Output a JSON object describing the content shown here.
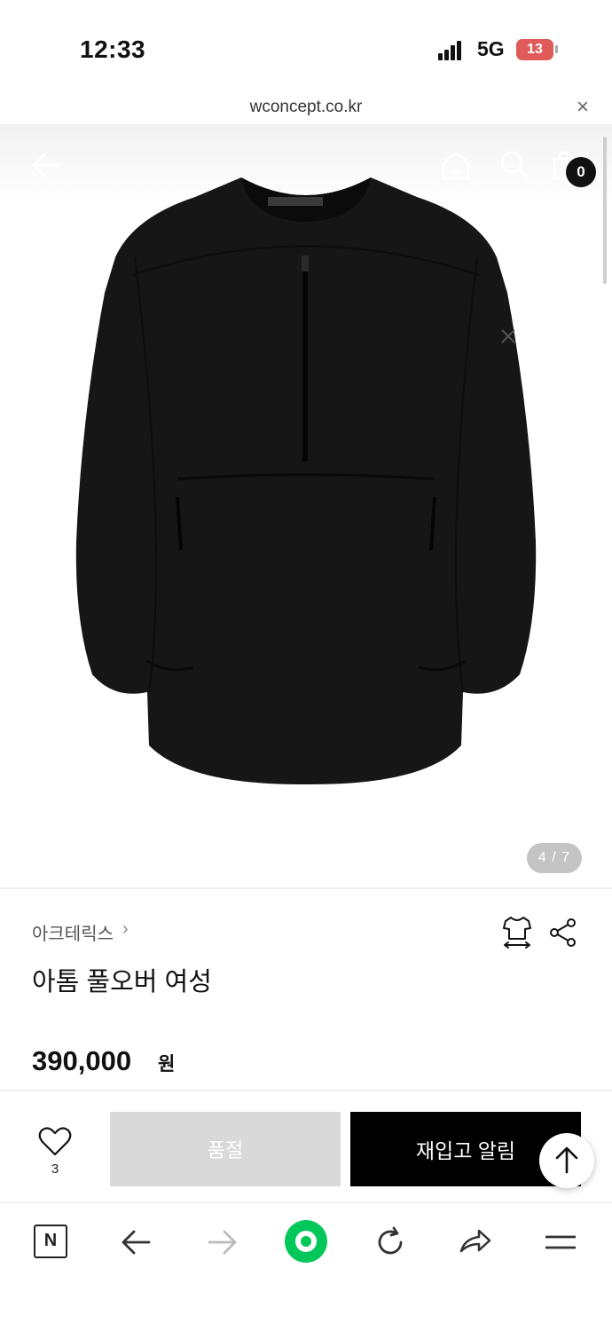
{
  "status_bar": {
    "time": "12:33",
    "network": "5G",
    "battery": "13"
  },
  "url_bar": {
    "url": "wconcept.co.kr",
    "close_symbol": "×"
  },
  "product_image": {
    "counter": "4 / 7",
    "cart_count": "0",
    "brand_logo_text": "ARC'TERYX"
  },
  "product": {
    "brand": "아크테릭스",
    "brand_chevron": "›",
    "title": "아톰 풀오버 여성",
    "price": "390,000",
    "price_unit": "원"
  },
  "purchase_bar": {
    "like_count": "3",
    "soldout_label": "품절",
    "restock_label": "재입고 알림"
  },
  "browser_nav": {
    "home_label": "N"
  },
  "colors": {
    "accent_green": "#03C75A",
    "button_black": "#000000",
    "soldout_gray": "#D9D9D9",
    "badge_red": "#E05A5A"
  },
  "icons": [
    "back-icon",
    "home-icon",
    "search-icon",
    "shopping-bag-icon",
    "size-guide-icon",
    "share-icon",
    "heart-icon",
    "arrow-up-icon",
    "forward-icon",
    "reload-icon",
    "send-icon",
    "menu-icon"
  ]
}
